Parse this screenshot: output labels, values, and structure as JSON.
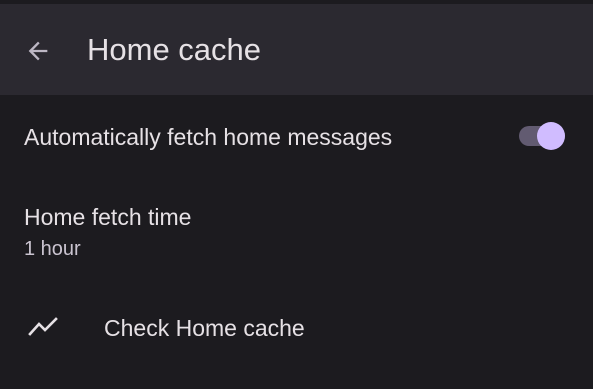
{
  "app_bar": {
    "title": "Home cache",
    "back_icon": "arrow-back-icon"
  },
  "preferences": {
    "auto_fetch": {
      "label": "Automatically fetch home messages",
      "enabled": true
    },
    "fetch_time": {
      "label": "Home fetch time",
      "value": "1 hour"
    },
    "check_cache": {
      "label": "Check Home cache",
      "icon": "trending-line-icon"
    }
  },
  "colors": {
    "background": "#1c1b1f",
    "app_bar": "#2b2930",
    "text": "#e6e1e5",
    "secondary_text": "#cac4d0",
    "switch_track": "#625b71",
    "switch_thumb": "#d0bcff"
  }
}
